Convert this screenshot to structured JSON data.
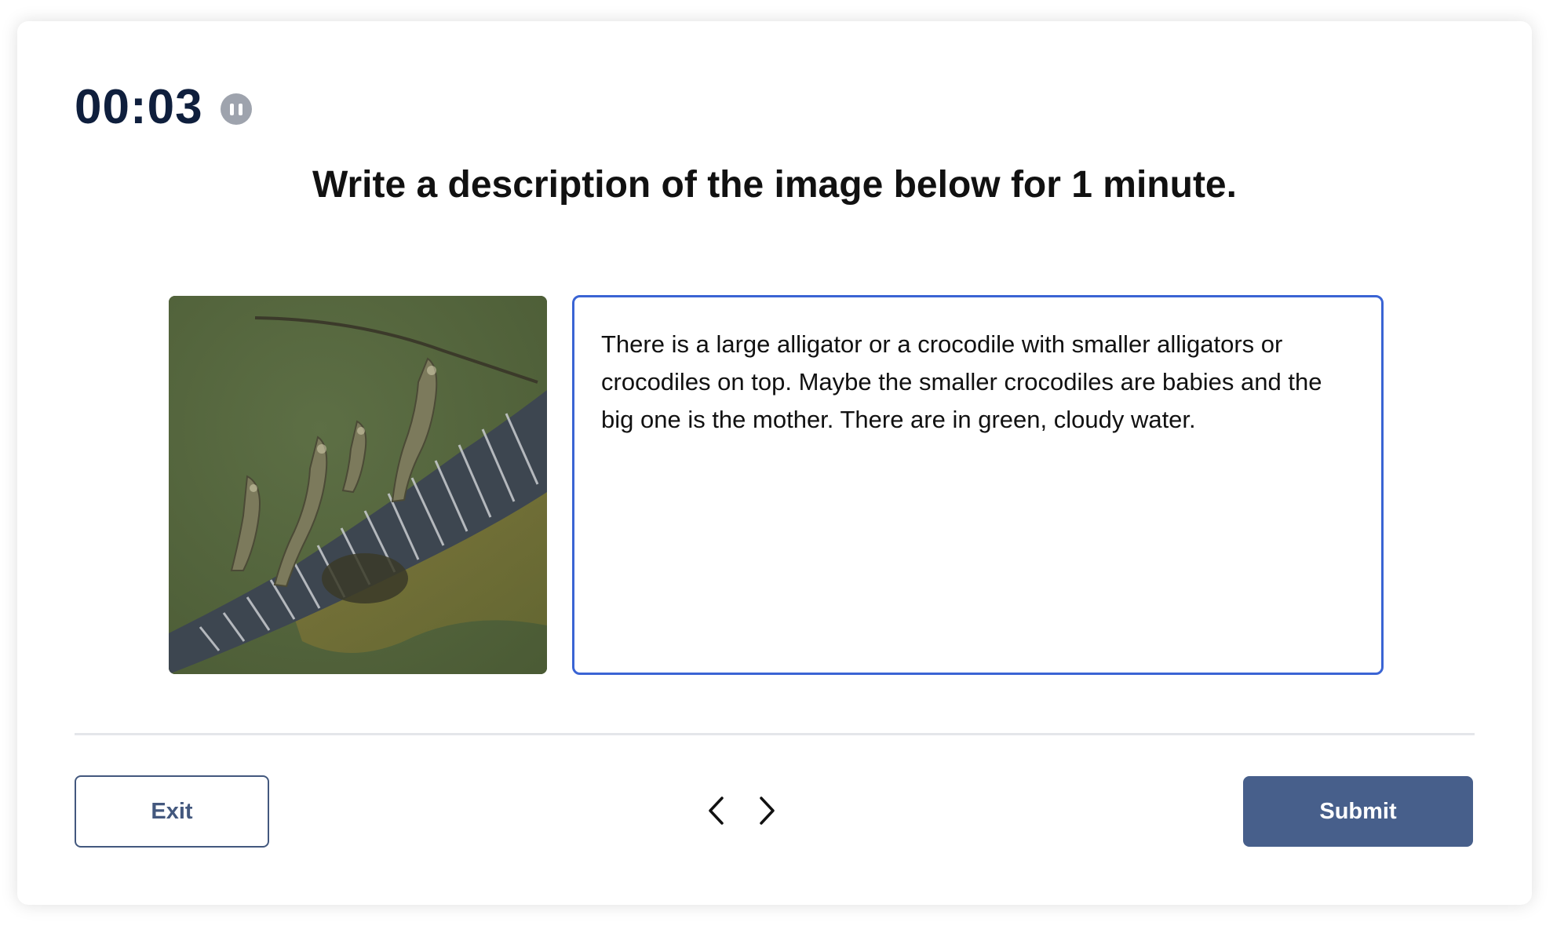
{
  "timer": {
    "value": "00:03",
    "pause_icon": "pause-icon"
  },
  "prompt": {
    "instruction": "Write a description of the image below for 1 minute."
  },
  "image": {
    "subject": "alligator-photo"
  },
  "answer": {
    "text": "There is a large alligator or a crocodile with smaller alligators or crocodiles on top. Maybe the smaller crocodiles are babies and the big one is the mother. There are in green, cloudy water."
  },
  "footer": {
    "exit_label": "Exit",
    "prev_icon": "chevron-left-icon",
    "next_icon": "chevron-right-icon",
    "submit_label": "Submit"
  },
  "colors": {
    "accent": "#3a64d4",
    "primary_button": "#475f8b",
    "timer_text": "#0f1f3d"
  }
}
